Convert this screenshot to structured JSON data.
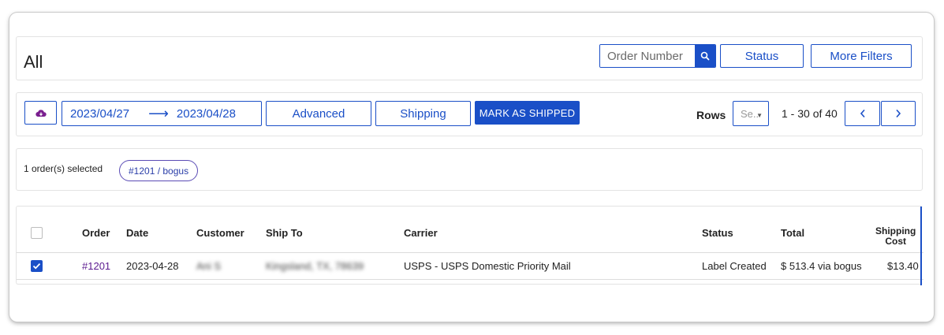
{
  "header": {
    "title": "All",
    "search_placeholder": "Order Number",
    "status_label": "Status",
    "more_filters_label": "More Filters"
  },
  "toolbar": {
    "date_from": "2023/04/27",
    "date_arrow": "⟶",
    "date_to": "2023/04/28",
    "advanced_label": "Advanced",
    "shipping_label": "Shipping",
    "mark_shipped_label": "MARK AS SHIPPED",
    "rows_label": "Rows",
    "rows_placeholder": "Se..",
    "paging_text": "1 - 30 of 40"
  },
  "selection": {
    "text": "1 order(s) selected",
    "chip": "#1201 / bogus"
  },
  "table": {
    "headers": {
      "order": "Order",
      "date": "Date",
      "customer": "Customer",
      "ship_to": "Ship To",
      "carrier": "Carrier",
      "status": "Status",
      "total": "Total",
      "shipping_cost_1": "Shipping",
      "shipping_cost_2": "Cost"
    },
    "rows": [
      {
        "order": "#1201",
        "date": "2023-04-28",
        "customer": "Ani S",
        "ship_to": "Kingsland, TX, 78639",
        "carrier": "USPS - USPS Domestic Priority Mail",
        "status": "Label Created",
        "total": "$ 513.4 via bogus",
        "shipping_cost": "$13.40"
      }
    ]
  },
  "colors": {
    "accent": "#1a4fc7",
    "link": "#5b1a8f"
  }
}
